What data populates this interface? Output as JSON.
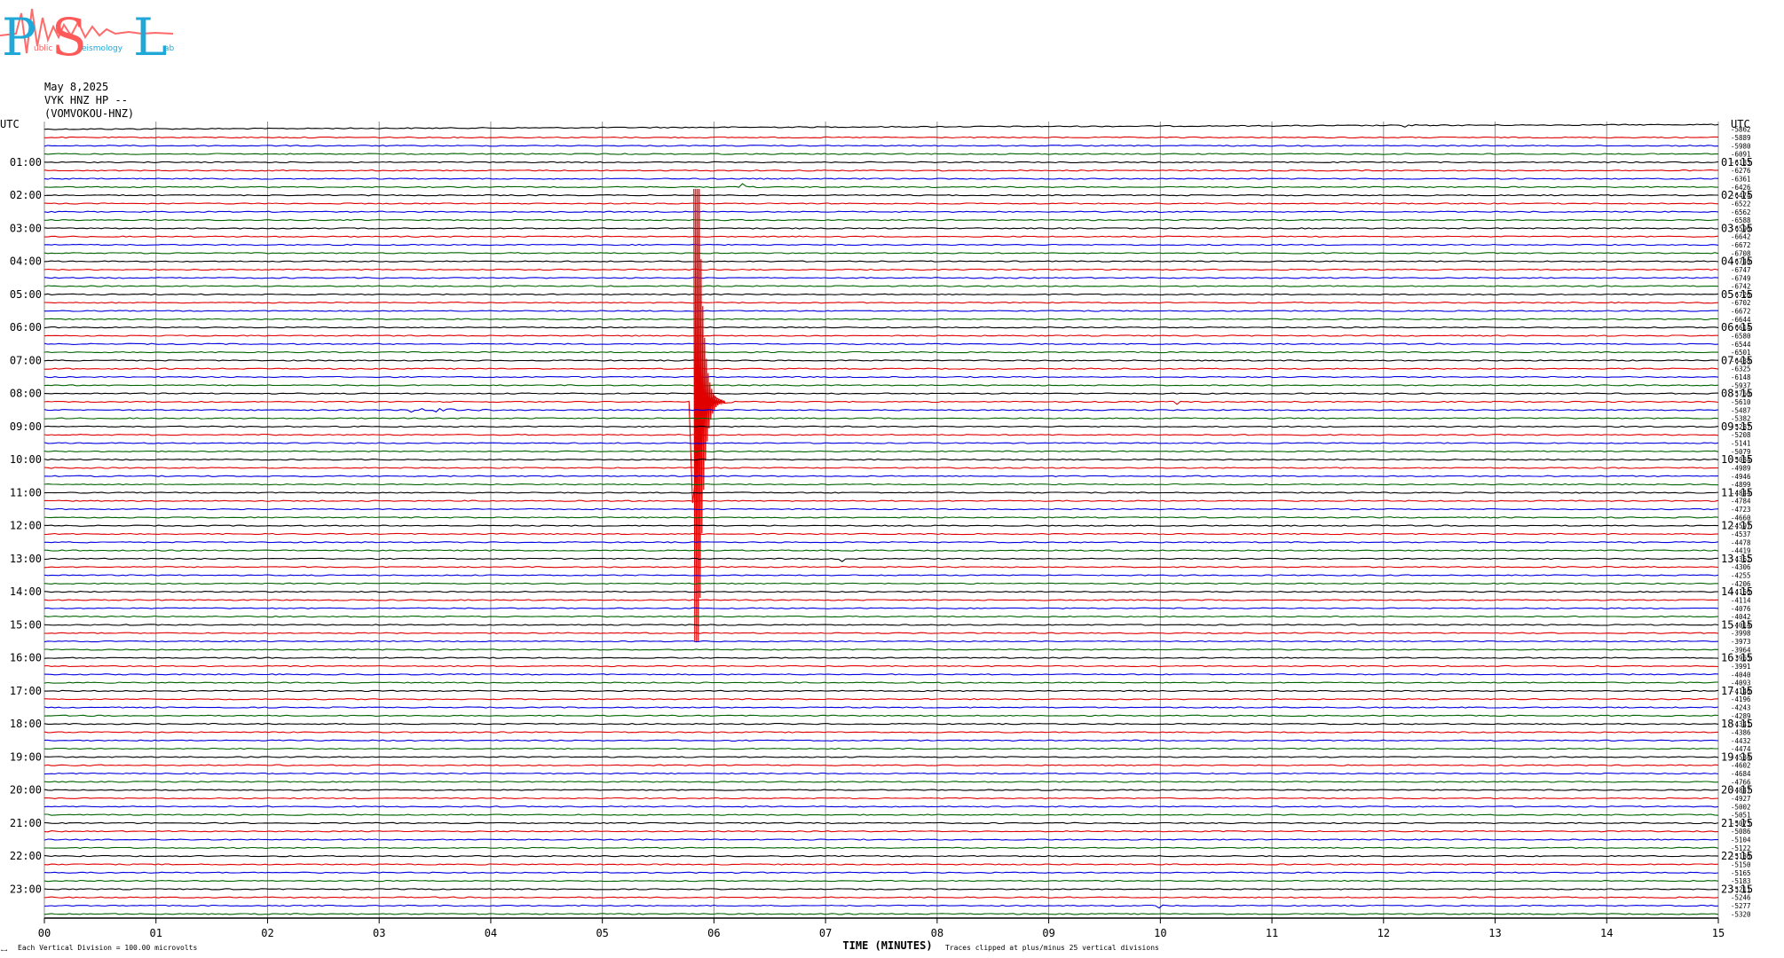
{
  "logo": {
    "big_letters": [
      "P",
      "S",
      "L"
    ],
    "small_words": [
      "ublic",
      "eismology",
      "ab"
    ]
  },
  "header": {
    "date": "May 8,2025",
    "station": "VYK HNZ HP --",
    "channel": "(VOMVOKOU-HNZ)"
  },
  "footer": {
    "scale_note": "Each Vertical Division =  100.00 microvolts",
    "clip_note": "Traces clipped at plus/minus 25 vertical divisions",
    "corner_mark": "←→"
  },
  "colors": {
    "trace_cycle": [
      "#000000",
      "#e00000",
      "#0000e0",
      "#006400"
    ],
    "grid": "#8c8c8c"
  },
  "chart_data": {
    "type": "line",
    "title": "",
    "xlabel": "TIME (MINUTES)",
    "ylabel": "",
    "left_axis_title": "UTC",
    "right_axis_title": "UTC",
    "xlim": [
      0,
      15
    ],
    "x_ticks": [
      "00",
      "01",
      "02",
      "03",
      "04",
      "05",
      "06",
      "07",
      "08",
      "09",
      "10",
      "11",
      "12",
      "13",
      "14",
      "15"
    ],
    "trace_minutes": 15,
    "left_hour_labels": [
      "01:00",
      "02:00",
      "03:00",
      "04:00",
      "05:00",
      "06:00",
      "07:00",
      "08:00",
      "09:00",
      "10:00",
      "11:00",
      "12:00",
      "13:00",
      "14:00",
      "15:00",
      "16:00",
      "17:00",
      "18:00",
      "19:00",
      "20:00",
      "21:00",
      "22:00",
      "23:00"
    ],
    "right_hour_labels": [
      "01:15",
      "02:15",
      "03:15",
      "04:15",
      "05:15",
      "06:15",
      "07:15",
      "08:15",
      "09:15",
      "10:15",
      "11:15",
      "12:15",
      "13:15",
      "14:15",
      "15:15",
      "16:15",
      "17:15",
      "18:15",
      "19:15",
      "20:15",
      "21:15",
      "22:15",
      "23:15"
    ],
    "trace_offsets": [
      "-5862",
      "-5889",
      "-5980",
      "-6091",
      "-6183",
      "-6276",
      "-6361",
      "-6426",
      "-6474",
      "-6522",
      "-6562",
      "-6588",
      "-6596",
      "-6642",
      "-6672",
      "-6708",
      "-6740",
      "-6747",
      "-6749",
      "-6742",
      "-6726",
      "-6702",
      "-6672",
      "-6644",
      "-6614",
      "-6580",
      "-6544",
      "-6501",
      "-6438",
      "-6325",
      "-6148",
      "-5937",
      "-5760",
      "-5610",
      "-5487",
      "-5382",
      "-5287",
      "-5208",
      "-5141",
      "-5079",
      "-5034",
      "-4989",
      "-4946",
      "-4899",
      "-4844",
      "-4784",
      "-4723",
      "-4660",
      "-4597",
      "-4537",
      "-4478",
      "-4419",
      "-4362",
      "-4306",
      "-4255",
      "-4206",
      "-4156",
      "-4114",
      "-4076",
      "-4042",
      "-4014",
      "-3998",
      "-3973",
      "-3964",
      "-3965",
      "-3991",
      "-4040",
      "-4093",
      "-4146",
      "-4196",
      "-4243",
      "-4289",
      "-4341",
      "-4386",
      "-4432",
      "-4474",
      "-4534",
      "-4602",
      "-4684",
      "-4766",
      "-4847",
      "-4927",
      "-5002",
      "-5051",
      "-5073",
      "-5086",
      "-5104",
      "-5122",
      "-5136",
      "-5150",
      "-5165",
      "-5183",
      "-5211",
      "-5246",
      "-5277",
      "-5320"
    ],
    "events": [
      {
        "trace": 0,
        "minute": 12.2,
        "amp": 5,
        "dur": 0.25
      },
      {
        "trace": 7,
        "minute": 6.25,
        "amp": 4,
        "dur": 0.35
      },
      {
        "trace": 33,
        "minute": 5.82,
        "amp": 200,
        "dur": 0.15,
        "clipped": true
      },
      {
        "trace": 33,
        "minute": 6.0,
        "amp": 12,
        "dur": 0.4
      },
      {
        "trace": 34,
        "minute": 3.25,
        "amp": 4,
        "dur": 2.5
      },
      {
        "trace": 33,
        "minute": 10.15,
        "amp": 3,
        "dur": 0.1
      },
      {
        "trace": 51,
        "minute": 4.0,
        "amp": 2,
        "dur": 0.2
      },
      {
        "trace": 52,
        "minute": 7.15,
        "amp": 3,
        "dur": 0.12
      },
      {
        "trace": 94,
        "minute": 10.0,
        "amp": 3,
        "dur": 0.2
      }
    ]
  }
}
